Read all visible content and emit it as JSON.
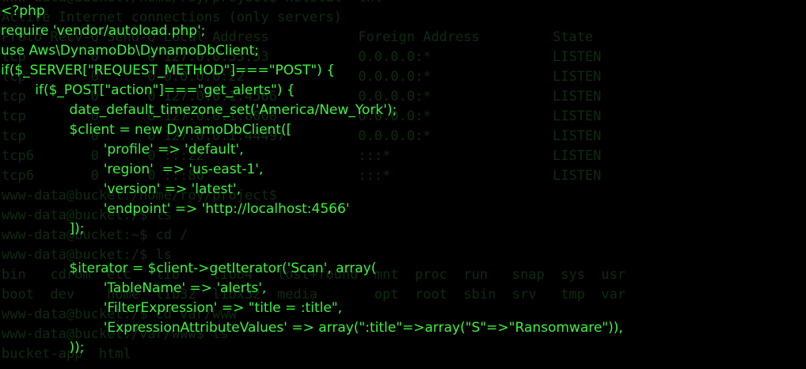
{
  "terminal": {
    "background_color": "#000000",
    "text_color": "#3df23d",
    "faded_text_color": "#0f2a10",
    "background_lines": [
      "www-data@bucket:/home/roy/project$ netstat -tnl",
      "Active Internet connections (only servers)",
      "Proto Recv-Q Send-Q Local Address           Foreign Address         State",
      "tcp        0      0 127.0.0.53:53           0.0.0.0:*               LISTEN",
      "tcp        0      0 0.0.0.0:22              0.0.0.0:*               LISTEN",
      "tcp        0      0 127.0.0.1:4566          0.0.0.0:*               LISTEN",
      "tcp        0      0 127.0.0.1:8000          0.0.0.0:*               LISTEN",
      "tcp        0      0 127.0.0.1:44497         0.0.0.0:*               LISTEN",
      "tcp6       0      0 :::22                   :::*                    LISTEN",
      "tcp6       0      0 :::80                   :::*                    LISTEN",
      "www-data@bucket:/home/roy/project$",
      "www-data@bucket:/$ ls",
      "www-data@bucket:~$ cd /",
      "www-data@bucket:/$ ls",
      "bin   cdrom  etc   lib    lib64   lost+found  mnt  proc  run   snap  sys  usr",
      "boot  dev    home  lib32  libx32  media       opt  root  sbin  srv   tmp  var",
      "www-data@bucket:/$ cd var/www",
      "www-data@bucket:/var/www$ ls",
      "bucket-app  html"
    ],
    "code_lines": [
      "<?php",
      "require 'vendor/autoload.php';",
      "use Aws\\DynamoDb\\DynamoDbClient;",
      "if($_SERVER[\"REQUEST_METHOD\"]===\"POST\") {",
      "        if($_POST[\"action\"]===\"get_alerts\") {",
      "                date_default_timezone_set('America/New_York');",
      "                $client = new DynamoDbClient([",
      "                        'profile' => 'default',",
      "                        'region'  => 'us-east-1',",
      "                        'version' => 'latest',",
      "                        'endpoint' => 'http://localhost:4566'",
      "                ]);",
      "",
      "                $iterator = $client->getIterator('Scan', array(",
      "                        'TableName' => 'alerts',",
      "                        'FilterExpression' => \"title = :title\",",
      "                        'ExpressionAttributeValues' => array(\":title\"=>array(\"S\"=>\"Ransomware\")),",
      "                ));"
    ]
  }
}
